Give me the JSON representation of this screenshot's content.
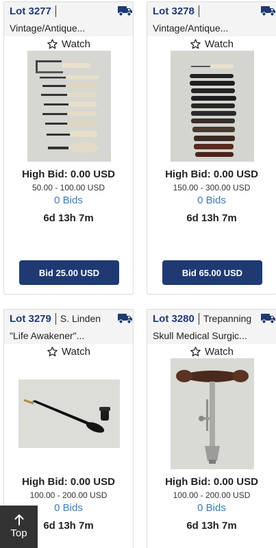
{
  "colors": {
    "brand_navy": "#1f3a73",
    "bids_link": "#3b7bbf",
    "row_bg": "#f4f4f4"
  },
  "lots": [
    {
      "lot_number": "Lot 3277",
      "consignor": "",
      "title": "Vintage/Antique...",
      "watch_label": "Watch",
      "high_bid": "High Bid: 0.00 USD",
      "estimate": "50.00 - 100.00 USD",
      "bids": "0 Bids",
      "time_left": "6d 13h 7m",
      "bid_button": "Bid 25.00 USD",
      "image_icon": "surgical-tools-photo"
    },
    {
      "lot_number": "Lot 3278",
      "consignor": "",
      "title": "Vintage/Antique...",
      "watch_label": "Watch",
      "high_bid": "High Bid: 0.00 USD",
      "estimate": "150.00 - 300.00 USD",
      "bids": "0 Bids",
      "time_left": "6d 13h 7m",
      "bid_button": "Bid 65.00 USD",
      "image_icon": "knives-photo"
    },
    {
      "lot_number": "Lot 3279",
      "consignor": "S. Linden",
      "title": "\"Life Awakener\"...",
      "watch_label": "Watch",
      "high_bid": "High Bid: 0.00 USD",
      "estimate": "100.00 - 200.00 USD",
      "bids": "0 Bids",
      "time_left": "6d 13h 7m",
      "image_icon": "life-awakener-photo"
    },
    {
      "lot_number": "Lot 3280",
      "consignor": "Trepanning",
      "title": "Skull Medical Surgic...",
      "watch_label": "Watch",
      "high_bid": "High Bid: 0.00 USD",
      "estimate": "100.00 - 200.00 USD",
      "bids": "0 Bids",
      "time_left": "6d 13h 7m",
      "image_icon": "trepanning-drill-photo"
    }
  ],
  "top_button": {
    "label": "Top"
  }
}
